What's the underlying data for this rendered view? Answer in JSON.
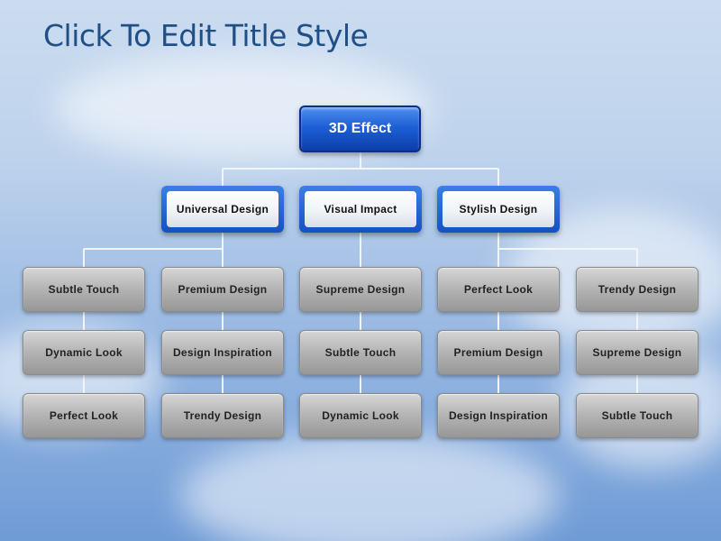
{
  "slide": {
    "title": "Click To Edit Title Style"
  },
  "diagram": {
    "root": "3D Effect",
    "groups": [
      {
        "label": "Universal Design",
        "columns": [
          [
            "Subtle Touch",
            "Dynamic Look",
            "Perfect Look"
          ],
          [
            "Premium Design",
            "Design Inspiration",
            "Trendy Design"
          ]
        ]
      },
      {
        "label": "Visual Impact",
        "columns": [
          [
            "Supreme Design",
            "Subtle Touch",
            "Dynamic Look"
          ]
        ]
      },
      {
        "label": "Stylish Design",
        "columns": [
          [
            "Perfect Look",
            "Premium Design",
            "Design Inspiration"
          ],
          [
            "Trendy Design",
            "Supreme Design",
            "Subtle Touch"
          ]
        ]
      }
    ]
  }
}
